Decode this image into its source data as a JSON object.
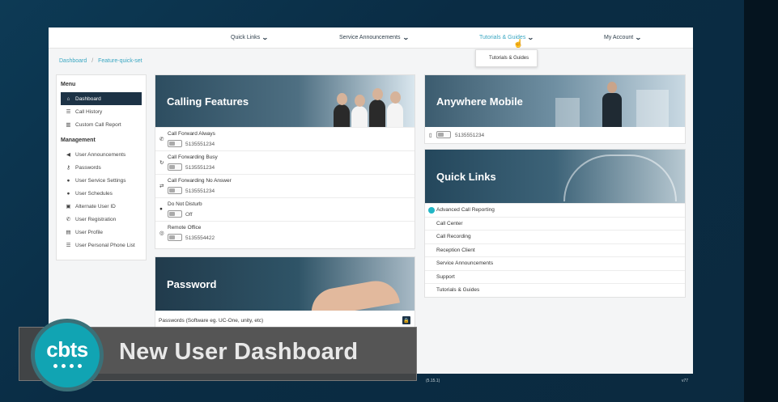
{
  "topnav": {
    "items": [
      {
        "label": "Quick Links"
      },
      {
        "label": "Service Announcements"
      },
      {
        "label": "Tutorials & Guides"
      },
      {
        "label": "My Account"
      }
    ],
    "dropdown_item": "Tutorials & Guides",
    "accent_color": "#3aa7c2"
  },
  "breadcrumb": {
    "home": "Dashboard",
    "separator": "/",
    "current": "Feature-quick-set"
  },
  "sidebar": {
    "menu_heading": "Menu",
    "menu_items": [
      {
        "label": "Dashboard",
        "icon": "home-icon"
      },
      {
        "label": "Call History",
        "icon": "list-icon"
      },
      {
        "label": "Custom Call Report",
        "icon": "chart-icon"
      }
    ],
    "management_heading": "Management",
    "management_items": [
      {
        "label": "User Announcements",
        "icon": "speaker-icon"
      },
      {
        "label": "Passwords",
        "icon": "key-icon"
      },
      {
        "label": "User Service Settings",
        "icon": "user-gear-icon"
      },
      {
        "label": "User Schedules",
        "icon": "user-calendar-icon"
      },
      {
        "label": "Alternate User ID",
        "icon": "id-card-icon"
      },
      {
        "label": "User Registration",
        "icon": "phone-icon"
      },
      {
        "label": "User Profile",
        "icon": "profile-card-icon"
      },
      {
        "label": "User Personal Phone List",
        "icon": "list-icon"
      }
    ]
  },
  "calling_features": {
    "title": "Calling Features",
    "rows": [
      {
        "label": "Call Forward Always",
        "value": "5135551234",
        "icon": "phone-icon"
      },
      {
        "label": "Call Forwarding Busy",
        "value": "5135551234",
        "icon": "busy-icon"
      },
      {
        "label": "Call Forwarding No Answer",
        "value": "5135551234",
        "icon": "no-answer-icon"
      },
      {
        "label": "Do Not Disturb",
        "value": "Off",
        "icon": "dnd-icon"
      },
      {
        "label": "Remote Office",
        "value": "5135554422",
        "icon": "remote-office-icon"
      }
    ]
  },
  "anywhere_mobile": {
    "title": "Anywhere Mobile",
    "number": "5135551234"
  },
  "quick_links": {
    "title": "Quick Links",
    "items": [
      "Advanced Call Reporting",
      "Call Center",
      "Call Recording",
      "Reception Client",
      "Service Announcements",
      "Support",
      "Tutorials & Guides"
    ]
  },
  "password": {
    "title": "Password",
    "row_label": "Passwords (Software eg. UC-One, unity, etc)"
  },
  "footer": {
    "version": "(5.15.1)",
    "build": "v77"
  },
  "overlay": {
    "logo_text": "cbts",
    "title": "New User Dashboard",
    "brand_color": "#11a4b3"
  }
}
